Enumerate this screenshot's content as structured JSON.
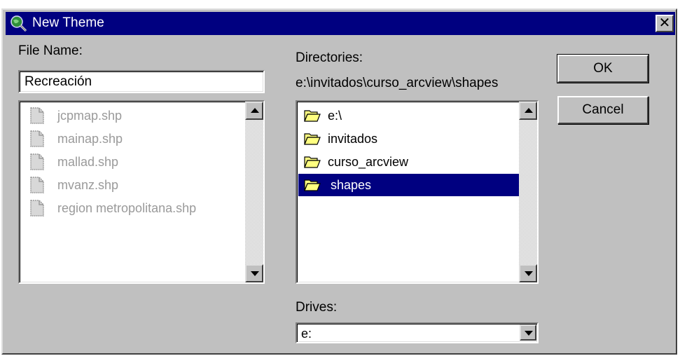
{
  "window": {
    "title": "New Theme",
    "title_icon": "globe-magnifier-icon",
    "close_glyph": "✕"
  },
  "file_name": {
    "label": "File Name:",
    "value": "Recreación"
  },
  "files": [
    {
      "name": "jcpmap.shp",
      "icon": "file-icon",
      "enabled": false
    },
    {
      "name": "mainap.shp",
      "icon": "file-icon",
      "enabled": false
    },
    {
      "name": "mallad.shp",
      "icon": "file-icon",
      "enabled": false
    },
    {
      "name": "mvanz.shp",
      "icon": "file-icon",
      "enabled": false
    },
    {
      "name": "region metropolitana.shp",
      "icon": "file-icon",
      "enabled": false
    }
  ],
  "directories": {
    "label": "Directories:",
    "current_path": "e:\\invitados\\curso_arcview\\shapes",
    "items": [
      {
        "name": "e:\\",
        "icon": "open-folder-icon",
        "selected": false
      },
      {
        "name": "invitados",
        "icon": "open-folder-icon",
        "selected": false
      },
      {
        "name": "curso_arcview",
        "icon": "open-folder-icon",
        "selected": false
      },
      {
        "name": "shapes",
        "icon": "open-folder-icon",
        "selected": true
      }
    ]
  },
  "drives": {
    "label": "Drives:",
    "selected": "e:"
  },
  "buttons": {
    "ok": "OK",
    "cancel": "Cancel"
  },
  "colors": {
    "titlebar": "#000080",
    "face": "#c0c0c0",
    "selection": "#000080",
    "folder": "#ffff80"
  }
}
